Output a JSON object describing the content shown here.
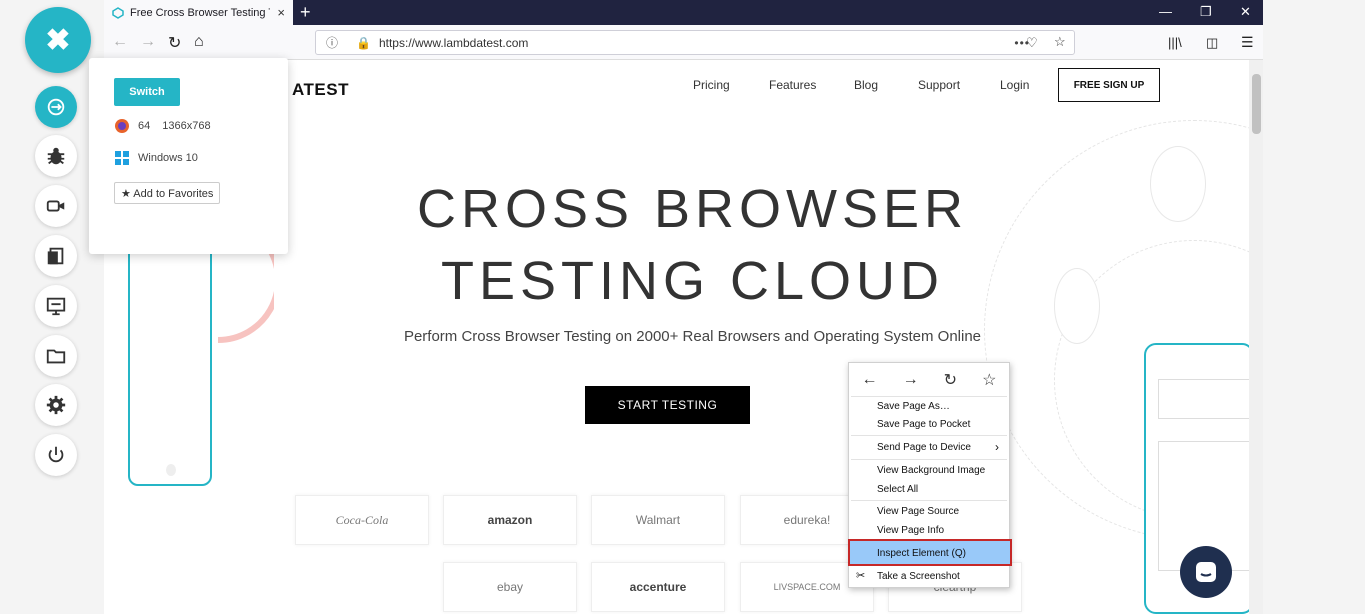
{
  "tab": {
    "title": "Free Cross Browser Testing Too",
    "close": "×"
  },
  "toolbar": {
    "new_tab": "+",
    "url": "https://www.lambdatest.com",
    "more": "•••"
  },
  "sidebar": {
    "close_label": "✖"
  },
  "session_popup": {
    "switch_label": "Switch",
    "browser_version": "64",
    "resolution": "1366x768",
    "os": "Windows 10",
    "favorites_label": "★ Add to Favorites"
  },
  "site": {
    "logo_text": "ATEST",
    "nav": [
      "Pricing",
      "Features",
      "Blog",
      "Support",
      "Login"
    ],
    "signup_label": "FREE SIGN UP",
    "hero_line1": "CROSS BROWSER",
    "hero_line2": "TESTING CLOUD",
    "subtitle": "Perform Cross Browser Testing on 2000+ Real Browsers and Operating System Online",
    "cta_label": "START TESTING",
    "brands_row1": [
      "Coca-Cola",
      "amazon",
      "Walmart",
      "edureka!"
    ],
    "brands_row2": [
      "ebay",
      "accenture",
      "LIVSPACE.COM",
      "cleartrip"
    ]
  },
  "context_menu": {
    "items": [
      "Save Page As…",
      "Save Page to Pocket",
      "Send Page to Device",
      "View Background Image",
      "Select All",
      "View Page Source",
      "View Page Info",
      "Inspect Element (Q)",
      "Take a Screenshot"
    ],
    "submenu_arrow": "›"
  },
  "colors": {
    "accent": "#25b5c6",
    "tabbar": "#202340",
    "highlight": "#99c9f9",
    "highlight_border": "#c62828"
  }
}
